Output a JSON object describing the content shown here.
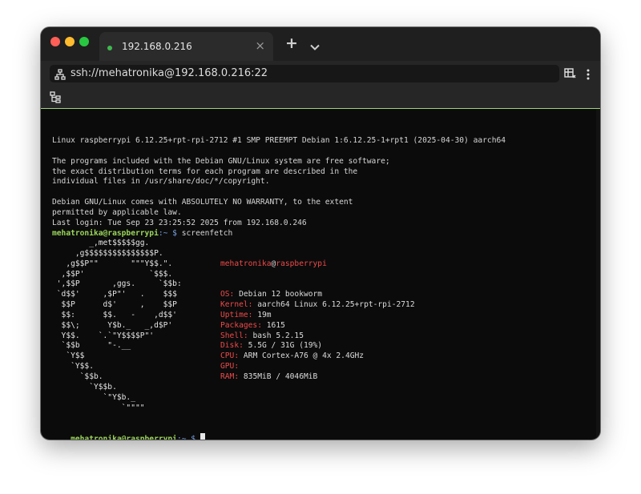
{
  "window": {
    "colors": {
      "close": "#ff5f57",
      "minimize": "#febc2e",
      "maximize": "#28c840",
      "accent_line": "#a3d17a"
    }
  },
  "tab": {
    "title": "192.168.0.216",
    "close_glyph": "×",
    "status_color": "#3fb950"
  },
  "toolbar": {
    "new_tab_glyph": "+",
    "dropdown_icon": "chevron-down-icon"
  },
  "address": {
    "url": "ssh://mehatronika@192.168.0.216:22",
    "icon": "network-icon"
  },
  "icons": {
    "layout": "layout-icon",
    "menu": "more-vertical-icon",
    "tree": "tree-icon"
  },
  "terminal": {
    "header_lines": [
      "Linux raspberrypi 6.12.25+rpt-rpi-2712 #1 SMP PREEMPT Debian 1:6.12.25-1+rpt1 (2025-04-30) aarch64",
      "",
      "The programs included with the Debian GNU/Linux system are free software;",
      "the exact distribution terms for each program are described in the",
      "individual files in /usr/share/doc/*/copyright.",
      "",
      "Debian GNU/Linux comes with ABSOLUTELY NO WARRANTY, to the extent",
      "permitted by applicable law.",
      "Last login: Tue Sep 23 23:25:52 2025 from 192.168.0.246"
    ],
    "prompt_user": "mehatronika@raspberrypi",
    "prompt_path": ":~ $",
    "command": "screenfetch",
    "logo_lines": [
      "        _,met$$$$$gg.",
      "     ,g$$$$$$$$$$$$$$$P.",
      "   ,g$$P\"\"       \"\"\"Y$$.\".",
      "  ,$$P'              `$$$.",
      " ',$$P       ,ggs.     `$$b:",
      " `d$$'     ,$P\"'   .    $$$",
      "  $$P      d$'     ,    $$P",
      "  $$:      $$.   -    ,d$$'",
      "  $$\\;      Y$b._   _,d$P'",
      "  Y$$.    `.`\"Y$$$$P\"'",
      "  `$$b      \"-.__",
      "   `Y$$",
      "    `Y$$.",
      "      `$$b.",
      "        `Y$$b.",
      "           `\"Y$b._",
      "               `\"\"\"\""
    ],
    "info": {
      "user": "mehatronika",
      "at": "@",
      "host": "raspberrypi",
      "rows": [
        {
          "label": "OS:",
          "value": "Debian 12 bookworm"
        },
        {
          "label": "Kernel:",
          "value": "aarch64 Linux 6.12.25+rpt-rpi-2712"
        },
        {
          "label": "Uptime:",
          "value": "19m"
        },
        {
          "label": "Packages:",
          "value": "1615"
        },
        {
          "label": "Shell:",
          "value": "bash 5.2.15"
        },
        {
          "label": "Disk:",
          "value": "5.5G / 31G (19%)"
        },
        {
          "label": "CPU:",
          "value": "ARM Cortex-A76 @ 4x 2.4GHz"
        },
        {
          "label": "GPU:",
          "value": ""
        },
        {
          "label": "RAM:",
          "value": "835MiB / 4046MiB"
        }
      ]
    }
  }
}
